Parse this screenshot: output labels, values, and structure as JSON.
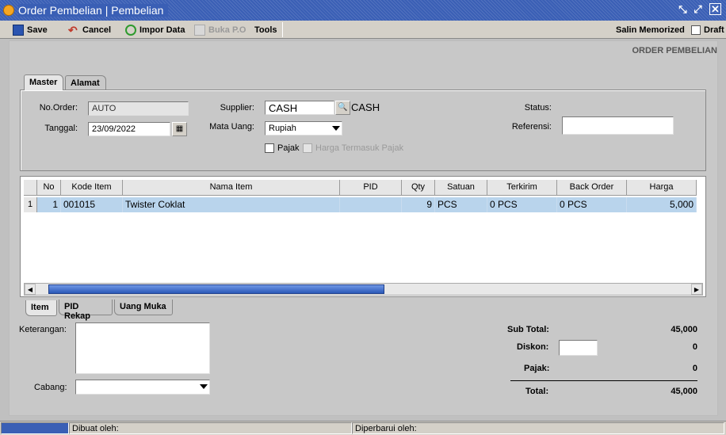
{
  "window": {
    "title": "Order Pembelian | Pembelian"
  },
  "toolbar": {
    "save": "Save",
    "cancel": "Cancel",
    "impor": "Impor Data",
    "buka_po": "Buka P.O",
    "tools": "Tools",
    "salin": "Salin Memorized",
    "draft": "Draft"
  },
  "page": {
    "heading": "ORDER PEMBELIAN"
  },
  "tabs": {
    "master": "Master",
    "alamat": "Alamat"
  },
  "form": {
    "no_order_label": "No.Order:",
    "no_order_value": "AUTO",
    "tanggal_label": "Tanggal:",
    "tanggal_value": "23/09/2022",
    "supplier_label": "Supplier:",
    "supplier_value": "CASH",
    "supplier_name": "CASH",
    "mata_uang_label": "Mata Uang:",
    "mata_uang_value": "Rupiah",
    "pajak_label": "Pajak",
    "harga_pajak_label": "Harga Termasuk Pajak",
    "status_label": "Status:",
    "referensi_label": "Referensi:",
    "referensi_value": ""
  },
  "grid": {
    "columns": [
      "No",
      "Kode Item",
      "Nama Item",
      "PID",
      "Qty",
      "Satuan",
      "Terkirim",
      "Back Order",
      "Harga"
    ],
    "rows": [
      {
        "indicator": "1",
        "no": "1",
        "kode": "001015",
        "nama": "Twister Coklat",
        "pid": "",
        "qty": "9",
        "satuan": "PCS",
        "terkirim": "0 PCS",
        "back_order": "0 PCS",
        "harga": "5,000"
      }
    ]
  },
  "bottom_tabs": {
    "item": "Item",
    "pid_rekap": "PID Rekap",
    "uang_muka": "Uang Muka"
  },
  "bottom": {
    "keterangan_label": "Keterangan:",
    "cabang_label": "Cabang:",
    "sub_total_label": "Sub Total:",
    "sub_total_value": "45,000",
    "diskon_label": "Diskon:",
    "diskon_value": "0",
    "pajak_label": "Pajak:",
    "pajak_value": "0",
    "total_label": "Total:",
    "total_value": "45,000"
  },
  "status_bar": {
    "dibuat": "Dibuat oleh:",
    "diperbarui": "Diperbarui oleh:"
  },
  "colors": {
    "titlebar": "#3a5fb5",
    "selected_row": "#b9d4ec",
    "scroll_thumb": "#3c6fd0"
  }
}
